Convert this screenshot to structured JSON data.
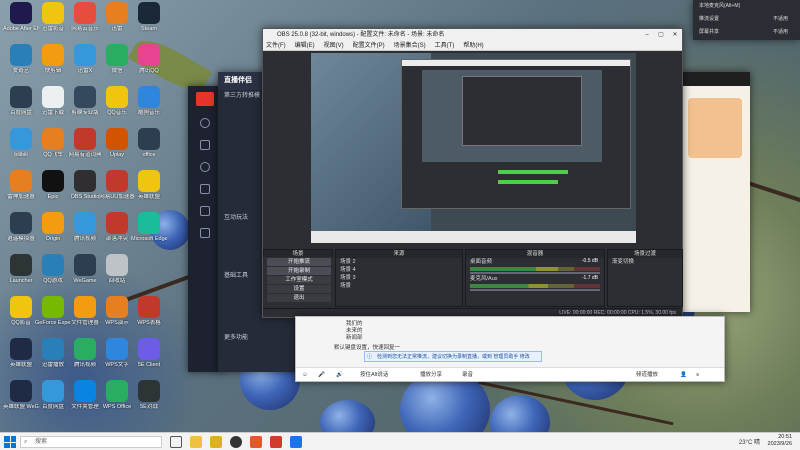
{
  "desktop_icons": [
    {
      "label": "Adobe After Effects",
      "color": "#1f1a4d",
      "col": 0,
      "row": 0
    },
    {
      "label": "迅雷影音",
      "color": "#f1c40f",
      "col": 1,
      "row": 0
    },
    {
      "label": "网易云音乐",
      "color": "#e74c3c",
      "col": 2,
      "row": 0
    },
    {
      "label": "迅雷",
      "color": "#e67e22",
      "col": 3,
      "row": 0
    },
    {
      "label": "Steam",
      "color": "#1b2838",
      "col": 4,
      "row": 0
    },
    {
      "label": "爱奇艺",
      "color": "#2980b9",
      "col": 0,
      "row": 1
    },
    {
      "label": "快剪辑",
      "color": "#f39c12",
      "col": 1,
      "row": 1
    },
    {
      "label": "迅雷X",
      "color": "#3498db",
      "col": 2,
      "row": 1
    },
    {
      "label": "微信",
      "color": "#27ae60",
      "col": 3,
      "row": 1
    },
    {
      "label": "腾讯QQ",
      "color": "#e84393",
      "col": 4,
      "row": 1
    },
    {
      "label": "百度网盘",
      "color": "#2c3e50",
      "col": 0,
      "row": 2
    },
    {
      "label": "迅雷下载",
      "color": "#ecf0f1",
      "col": 1,
      "row": 2
    },
    {
      "label": "剪映专业版",
      "color": "#34495e",
      "col": 2,
      "row": 2
    },
    {
      "label": "QQ音乐",
      "color": "#f1c40f",
      "col": 3,
      "row": 2
    },
    {
      "label": "酷狗音乐",
      "color": "#2e86de",
      "col": 4,
      "row": 2
    },
    {
      "label": "bilibili",
      "color": "#3498db",
      "col": 0,
      "row": 3
    },
    {
      "label": "QQ飞车",
      "color": "#e67e22",
      "col": 1,
      "row": 3
    },
    {
      "label": "网易有道词典",
      "color": "#c0392b",
      "col": 2,
      "row": 3
    },
    {
      "label": "Uplay",
      "color": "#d35400",
      "col": 3,
      "row": 3
    },
    {
      "label": "office",
      "color": "#2c3e50",
      "col": 4,
      "row": 3
    },
    {
      "label": "雷神加速器",
      "color": "#e67e22",
      "col": 0,
      "row": 4
    },
    {
      "label": "Epic",
      "color": "#111111",
      "col": 1,
      "row": 4
    },
    {
      "label": "OBS Studio",
      "color": "#302e31",
      "col": 2,
      "row": 4
    },
    {
      "label": "网易UU加速器",
      "color": "#c0392b",
      "col": 3,
      "row": 4
    },
    {
      "label": "英雄联盟",
      "color": "#f1c40f",
      "col": 4,
      "row": 4
    },
    {
      "label": "逍遥模拟器",
      "color": "#2c3e50",
      "col": 0,
      "row": 5
    },
    {
      "label": "Origin",
      "color": "#f39c12",
      "col": 1,
      "row": 5
    },
    {
      "label": "腾讯视频",
      "color": "#3498db",
      "col": 2,
      "row": 5
    },
    {
      "label": "部落冲突",
      "color": "#c0392b",
      "col": 3,
      "row": 5
    },
    {
      "label": "Microsoft Edge",
      "color": "#1abc9c",
      "col": 4,
      "row": 5
    },
    {
      "label": "Launcher",
      "color": "#2d3436",
      "col": 0,
      "row": 6
    },
    {
      "label": "QQ游戏",
      "color": "#2980b9",
      "col": 1,
      "row": 6
    },
    {
      "label": "WeGame",
      "color": "#2c3e50",
      "col": 2,
      "row": 6
    },
    {
      "label": "回收站",
      "color": "#bdc3c7",
      "col": 3,
      "row": 6
    },
    {
      "label": "QQ影音",
      "color": "#f1c40f",
      "col": 0,
      "row": 7
    },
    {
      "label": "GeForce Experience",
      "color": "#76b900",
      "col": 1,
      "row": 7
    },
    {
      "label": "文件管理器",
      "color": "#f39c12",
      "col": 2,
      "row": 7
    },
    {
      "label": "WPS演示",
      "color": "#e67e22",
      "col": 3,
      "row": 7
    },
    {
      "label": "WPS表格",
      "color": "#c0392b",
      "col": 4,
      "row": 7
    },
    {
      "label": "英雄联盟",
      "color": "#1f2a44",
      "col": 0,
      "row": 8
    },
    {
      "label": "迅雷播放",
      "color": "#2980b9",
      "col": 1,
      "row": 8
    },
    {
      "label": "腾讯视频",
      "color": "#27ae60",
      "col": 2,
      "row": 8
    },
    {
      "label": "WPS文字",
      "color": "#2e86de",
      "col": 3,
      "row": 8
    },
    {
      "label": "5E Client",
      "color": "#6c5ce7",
      "col": 4,
      "row": 8
    },
    {
      "label": "英雄联盟 WeGame",
      "color": "#1f2a44",
      "col": 0,
      "row": 9
    },
    {
      "label": "百度网盘",
      "color": "#3498db",
      "col": 1,
      "row": 9
    },
    {
      "label": "文件夹管理",
      "color": "#0984e3",
      "col": 2,
      "row": 9
    },
    {
      "label": "WPS Office",
      "color": "#27ae60",
      "col": 3,
      "row": 9
    },
    {
      "label": "5E对战",
      "color": "#2d3436",
      "col": 4,
      "row": 9
    }
  ],
  "streaming_app": {
    "brand": "直播伴侣",
    "subtitle": "第三方转推模",
    "section1": "互动玩法",
    "section2": "基础工具",
    "more": "更多功能"
  },
  "obs": {
    "title": "OBS 25.0.8 (32-bit, windows) - 配置文件: 未命名 - 场景: 未命名",
    "menu": [
      "文件(F)",
      "编辑(E)",
      "视图(V)",
      "配置文件(P)",
      "场景集合(S)",
      "工具(T)",
      "帮助(H)"
    ],
    "docks": {
      "scenes_header": "场景",
      "scenes": [
        "场景 2",
        "场景 4",
        "场景 3",
        "场景"
      ],
      "sources_header": "来源",
      "mixer_header": "混音器",
      "mixer": [
        {
          "name": "桌面音频",
          "db": "-0.5 dB",
          "level": 0.68
        },
        {
          "name": "麦克风/Aux",
          "db": "-1.7 dB",
          "level": 0.6
        }
      ],
      "transitions_header": "场景过渡",
      "transition_value": "渐变切换",
      "controls_header": "控件",
      "controls": [
        "开始推流",
        "开始录制",
        "工作室模式",
        "设置",
        "退出"
      ]
    },
    "status": "LIVE: 00:00:00   REC: 00:00:00   CPU: 1.5%, 30.00 fps"
  },
  "chat": {
    "lines": [
      "我们的",
      "未来的",
      "新闻部"
    ],
    "notice": "检测到您无法正常推流，建议切换为录制直播，或到 管理员助手 修改",
    "bottom_text": "默认键盘设置，快速回复一",
    "toolbar": [
      "按住Alt说话",
      "播放分享",
      "录音"
    ],
    "right_btn": "频道播放"
  },
  "right_panel": {
    "rows": [
      {
        "label": "本地麦克风(Alt+M)",
        "value": ""
      },
      {
        "label": "推流设置",
        "value": "不适用"
      },
      {
        "label": "屏幕共享",
        "value": "不适用"
      }
    ]
  },
  "taskbar": {
    "search_placeholder": "搜索",
    "weather": "23°C 晴",
    "time": "20:51",
    "date": "2023/9/26"
  }
}
